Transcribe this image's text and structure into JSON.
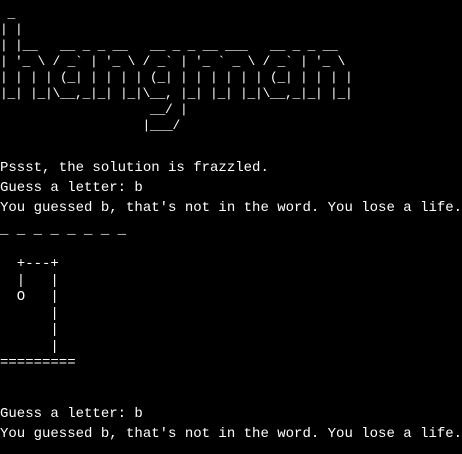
{
  "banner": {
    "ascii_art": " _\n| |\n| |__   __ _ _ __   __ _ _ __ ___   __ _ _ __\n| '_ \\ / _` | '_ \\ / _` | '_ ` _ \\ / _` | '_ \\\n| | | | (_| | | | | (_| | | | | | | (_| | | | |\n|_| |_|\\__,_|_| |_|\\__, |_| |_| |_|\\__,_|_| |_|\n                    __/ |\n                   |___/",
    "label": "hangman"
  },
  "output": {
    "solution_line": "Pssst, the solution is frazzled.",
    "prompt_1": "Guess a letter: b",
    "result_1": "You guessed b, that's not in the word. You lose a life.",
    "word_progress": "_ _ _ _ _ _ _ _",
    "gallows": "  +---+\n  |   |\n  O   |\n      |\n      |\n      |\n=========",
    "prompt_2": "Guess a letter: b",
    "result_2": "You guessed b, that's not in the word. You lose a life."
  },
  "colors": {
    "background": "#000000",
    "text": "#ffffff"
  }
}
